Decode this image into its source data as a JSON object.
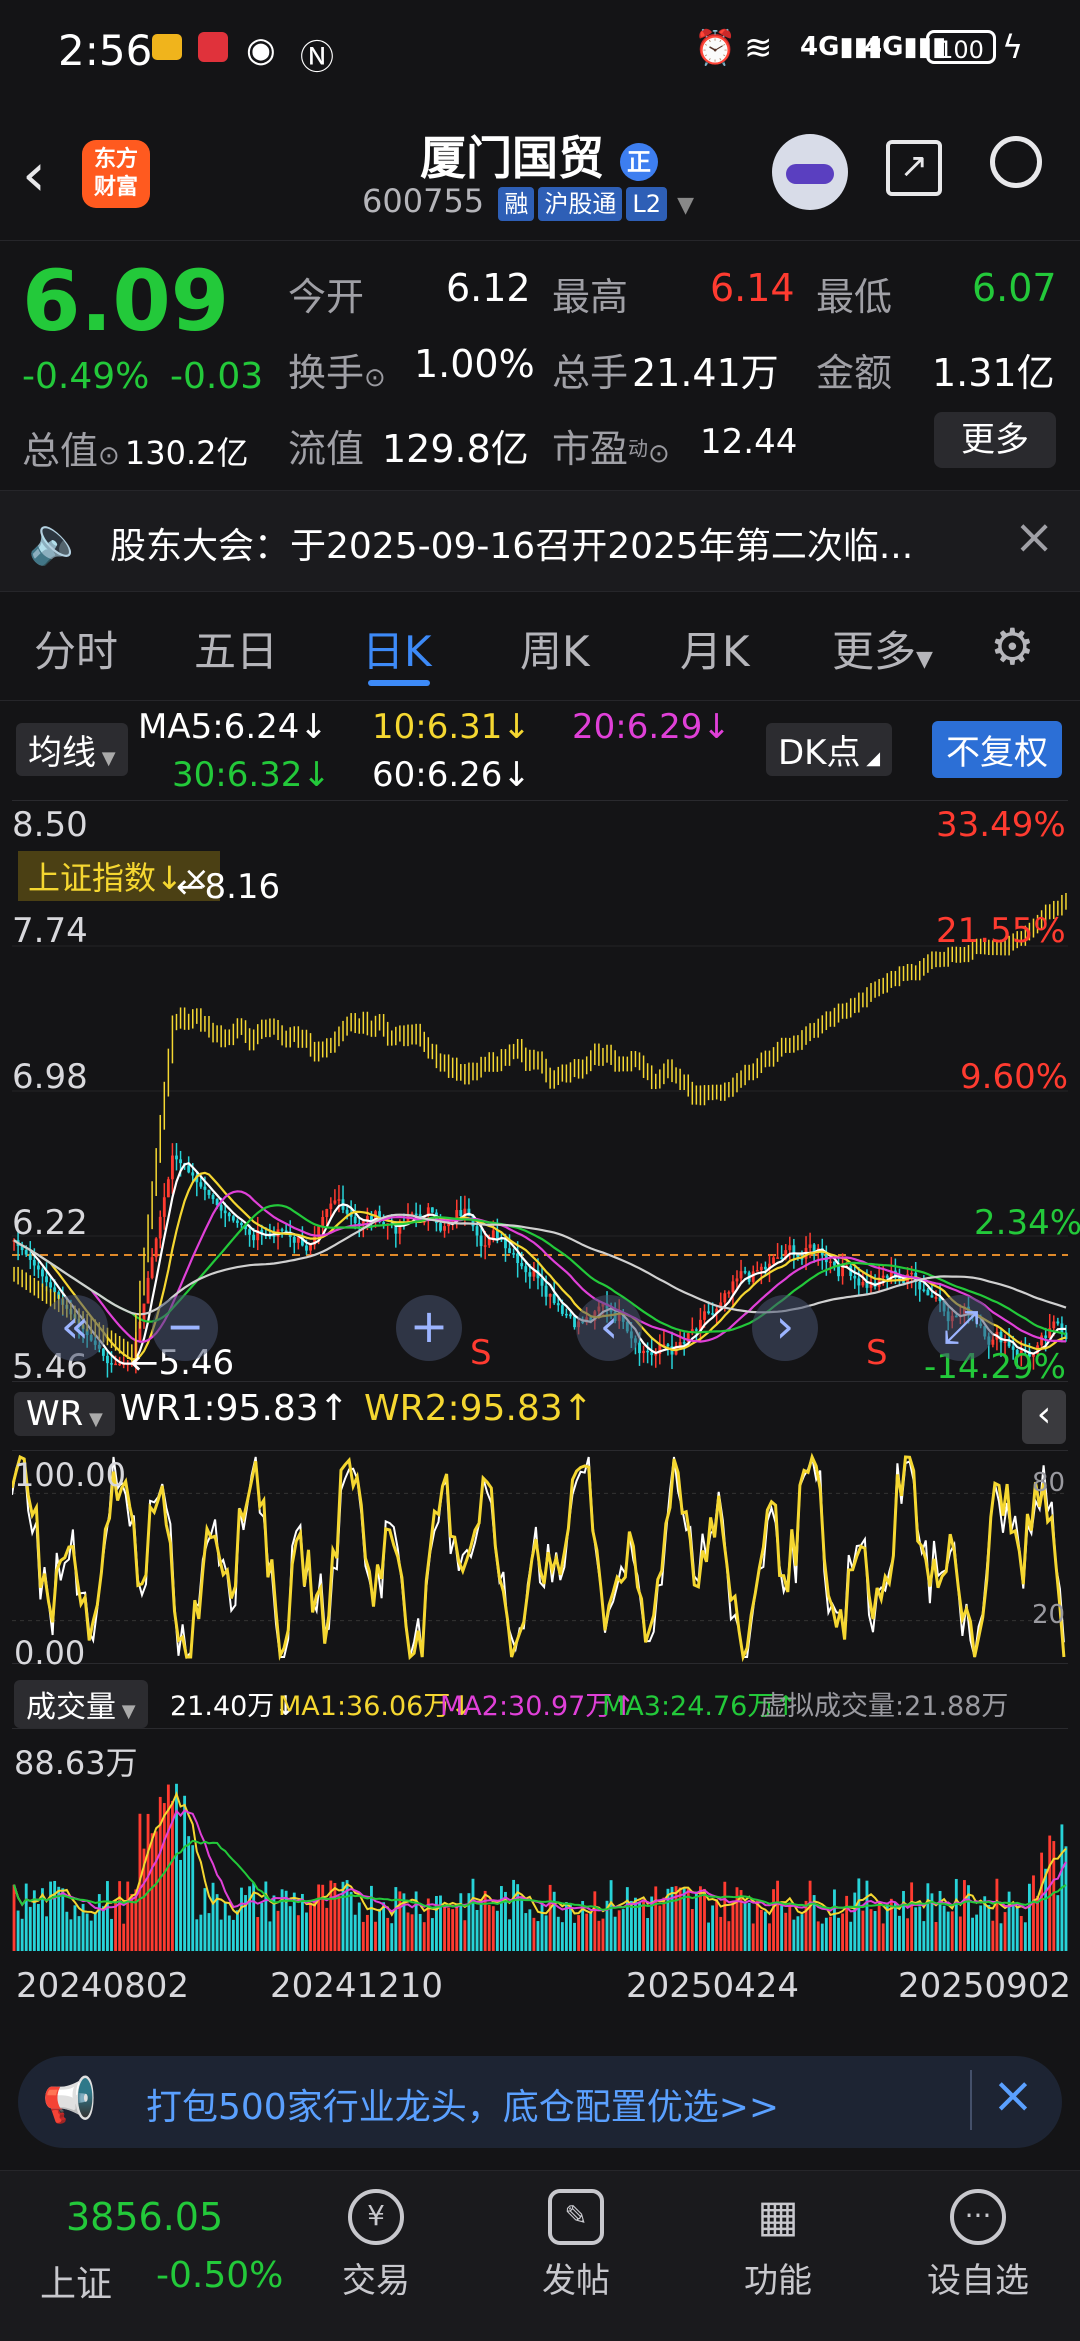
{
  "status_bar": {
    "time": "2:56",
    "battery": "100"
  },
  "header": {
    "logo_top": "东方",
    "logo_bottom": "财富",
    "stock_name": "厦门国贸",
    "name_badge": "正",
    "stock_code": "600755",
    "tags": [
      "融",
      "沪股通",
      "L2"
    ]
  },
  "quote": {
    "price": "6.09",
    "change_pct": "-0.49%",
    "change_amt": "-0.03",
    "open_label": "今开",
    "open": "6.12",
    "high_label": "最高",
    "high": "6.14",
    "low_label": "最低",
    "low": "6.07",
    "turnover_label": "换手",
    "turnover": "1.00%",
    "volume_label": "总手",
    "volume": "21.41万",
    "amount_label": "金额",
    "amount": "1.31亿",
    "mktcap_label": "总值",
    "mktcap": "130.2亿",
    "float_label": "流值",
    "float": "129.8亿",
    "pe_label": "市盈",
    "pe_sup": "动",
    "pe": "12.44",
    "more_button": "更多"
  },
  "notice": {
    "text": "股东大会：于2025-09-16召开2025年第二次临..."
  },
  "tabs": [
    "分时",
    "五日",
    "日K",
    "周K",
    "月K",
    "更多"
  ],
  "active_tab": 2,
  "chart": {
    "ma_chip": "均线",
    "ma5": "MA5:6.24↓",
    "ma10": "10:6.31↓",
    "ma20": "20:6.29↓",
    "ma30": "30:6.32↓",
    "ma60": "60:6.26↓",
    "dk_chip": "DK点",
    "fq_chip": "不复权",
    "overlay_label": "上证指数",
    "overlay_close": "×",
    "y_labels": [
      "8.50",
      "7.74",
      "6.98",
      "6.22",
      "5.46"
    ],
    "pct_labels": [
      "33.49%",
      "21.55%",
      "9.60%",
      "2.34%",
      "-14.29%"
    ],
    "max_mark": "←8.16",
    "min_mark": "←5.46",
    "s_mark": "S",
    "wr_chip": "WR",
    "wr1": "WR1:95.83↑",
    "wr2": "WR2:95.83↑",
    "wr_top": "100.00",
    "wr_bottom": "0.00",
    "wr_right_top": "80",
    "wr_right_bottom": "20",
    "vol_chip": "成交量",
    "vol_now": "21.40万↓",
    "vol_ma1": "MA1:36.06万↓",
    "vol_ma2": "MA2:30.97万↑",
    "vol_ma3": "MA3:24.76万↑",
    "vol_virtual": "虚拟成交量:21.88万",
    "vol_max": "88.63万",
    "dates": [
      "20240802",
      "20241210",
      "20250424",
      "20250902"
    ]
  },
  "chart_data": {
    "type": "candlestick",
    "y_range": [
      5.46,
      8.5
    ],
    "x_labels": [
      "20240802",
      "20241210",
      "20250424",
      "20250902"
    ],
    "series": [
      {
        "name": "上证指数",
        "color": "#f5d731"
      },
      {
        "name": "MA5",
        "color": "#ffffff"
      },
      {
        "name": "10",
        "color": "#f5d731"
      },
      {
        "name": "20",
        "color": "#e040d8"
      },
      {
        "name": "30",
        "color": "#23c93a"
      },
      {
        "name": "60",
        "color": "#d0d0d0"
      }
    ],
    "candle_colors": {
      "up": "#ff3b30",
      "down": "#27d3d8"
    }
  },
  "ad": {
    "text": "打包500家行业龙头，底仓配置优选>>"
  },
  "bottom_nav": {
    "index_value": "3856.05",
    "index_name": "上证",
    "index_change": "-0.50%",
    "items": [
      "交易",
      "发帖",
      "功能",
      "设自选"
    ]
  },
  "colors": {
    "up": "#ff3b30",
    "down": "#23c93a",
    "accent": "#3d8af7",
    "index_line": "#f5d731"
  }
}
